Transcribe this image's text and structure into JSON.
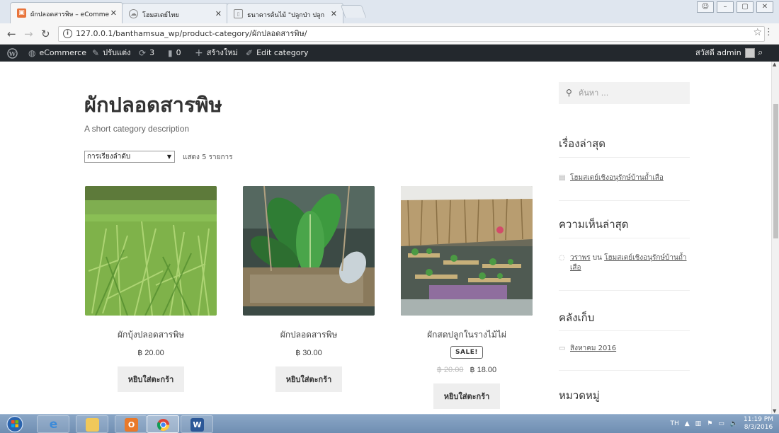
{
  "browser": {
    "tabs": [
      {
        "title": "ผักปลอดสารพิษ – eComme"
      },
      {
        "title": "โฮมสเตย์ไทย"
      },
      {
        "title": "ธนาคารต้นไม้ \"ปลูกป่า ปลูก"
      }
    ],
    "url": "127.0.0.1/banthamsua_wp/product-category/ผักปลอดสารพิษ/"
  },
  "adminbar": {
    "site": "eCommerce",
    "customize": "ปรับแต่ง",
    "updates": "3",
    "comments": "0",
    "new": "สร้างใหม่",
    "edit": "Edit category",
    "greeting": "สวัสดี admin"
  },
  "page": {
    "title": "ผักปลอดสารพิษ",
    "description": "A short category description",
    "sort": "การเรียงลำดับ",
    "result_count": "แสดง 5 รายการ"
  },
  "products": [
    {
      "name": "ผักบุ้งปลอดสารพิษ",
      "price": "฿ 20.00",
      "button": "หยิบใส่ตะกร้า"
    },
    {
      "name": "ผักปลอดสารพิษ",
      "price": "฿ 30.00",
      "button": "หยิบใส่ตะกร้า"
    },
    {
      "name": "ผักสดปลูกในรางไม้ไผ่",
      "sale": "SALE!",
      "old_price": "฿ 20.00",
      "price": "฿ 18.00",
      "button": "หยิบใส่ตะกร้า"
    }
  ],
  "sidebar": {
    "search_placeholder": "ค้นหา ...",
    "recent_posts_title": "เรื่องล่าสุด",
    "recent_post": "โฮมสเตย์เชิงอนุรักษ์บ้านถ้ำเสือ",
    "recent_comments_title": "ความเห็นล่าสุด",
    "comment_author": "วราพร",
    "comment_on": "บน",
    "comment_post": "โฮมสเตย์เชิงอนุรักษ์บ้านถ้ำเสือ",
    "archives_title": "คลังเก็บ",
    "archive_item": "สิงหาคม 2016",
    "categories_title": "หมวดหมู่"
  },
  "taskbar": {
    "lang": "TH",
    "time": "11:19 PM",
    "date": "8/3/2016"
  }
}
